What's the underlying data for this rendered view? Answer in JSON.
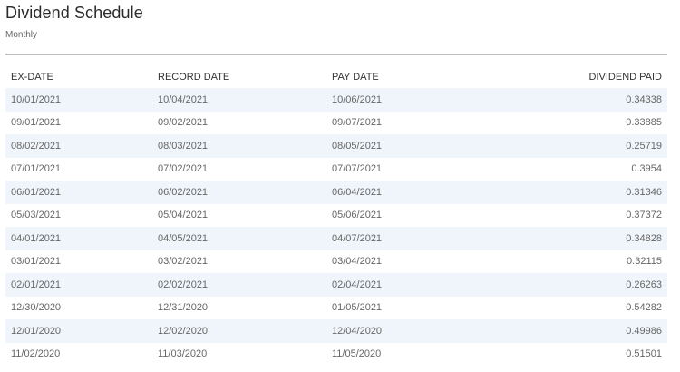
{
  "header": {
    "title": "Dividend Schedule",
    "subtitle": "Monthly"
  },
  "table": {
    "columns": [
      "EX-DATE",
      "RECORD DATE",
      "PAY DATE",
      "DIVIDEND PAID"
    ],
    "rows": [
      [
        "10/01/2021",
        "10/04/2021",
        "10/06/2021",
        "0.34338"
      ],
      [
        "09/01/2021",
        "09/02/2021",
        "09/07/2021",
        "0.33885"
      ],
      [
        "08/02/2021",
        "08/03/2021",
        "08/05/2021",
        "0.25719"
      ],
      [
        "07/01/2021",
        "07/02/2021",
        "07/07/2021",
        "0.3954"
      ],
      [
        "06/01/2021",
        "06/02/2021",
        "06/04/2021",
        "0.31346"
      ],
      [
        "05/03/2021",
        "05/04/2021",
        "05/06/2021",
        "0.37372"
      ],
      [
        "04/01/2021",
        "04/05/2021",
        "04/07/2021",
        "0.34828"
      ],
      [
        "03/01/2021",
        "03/02/2021",
        "03/04/2021",
        "0.32115"
      ],
      [
        "02/01/2021",
        "02/02/2021",
        "02/04/2021",
        "0.26263"
      ],
      [
        "12/30/2020",
        "12/31/2020",
        "01/05/2021",
        "0.54282"
      ],
      [
        "12/01/2020",
        "12/02/2020",
        "12/04/2020",
        "0.49986"
      ],
      [
        "11/02/2020",
        "11/03/2020",
        "11/05/2020",
        "0.51501"
      ]
    ]
  }
}
